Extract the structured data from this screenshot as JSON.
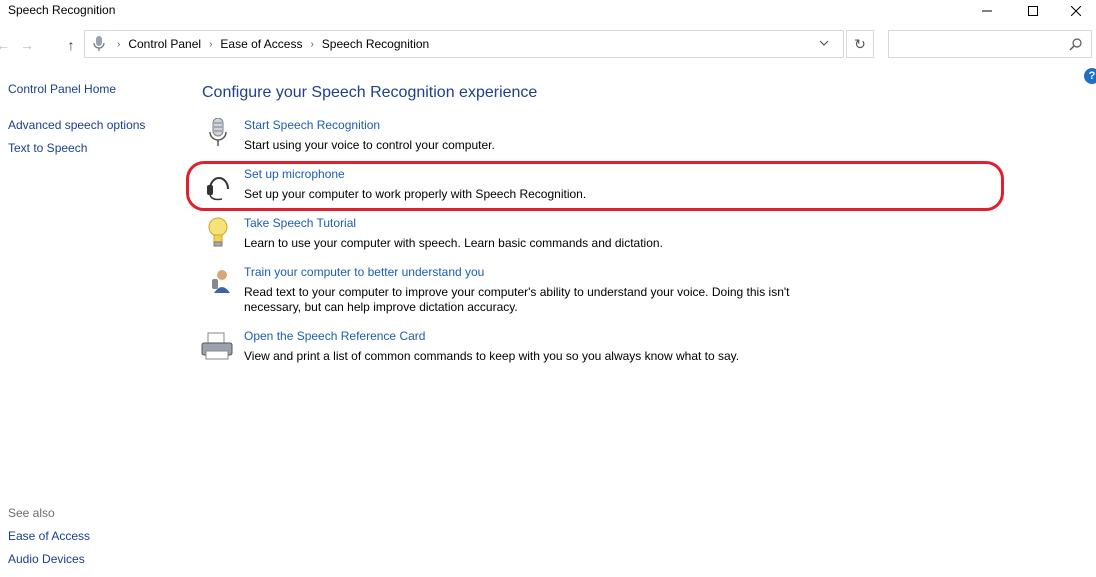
{
  "window": {
    "title": "Speech Recognition"
  },
  "breadcrumb": [
    "Control Panel",
    "Ease of Access",
    "Speech Recognition"
  ],
  "search": {
    "placeholder": ""
  },
  "sidebar": {
    "links": [
      "Control Panel Home",
      "Advanced speech options",
      "Text to Speech"
    ]
  },
  "seealso": {
    "title": "See also",
    "links": [
      "Ease of Access",
      "Audio Devices"
    ]
  },
  "main": {
    "title": "Configure your Speech Recognition experience",
    "tasks": [
      {
        "link": "Start Speech Recognition",
        "desc": "Start using your voice to control your computer.",
        "icon": "microphone-icon"
      },
      {
        "link": "Set up microphone",
        "desc": "Set up your computer to work properly with Speech Recognition.",
        "icon": "headset-icon"
      },
      {
        "link": "Take Speech Tutorial",
        "desc": "Learn to use your computer with speech.  Learn basic commands and dictation.",
        "icon": "lightbulb-icon"
      },
      {
        "link": "Train your computer to better understand you",
        "desc": "Read text to your computer to improve your computer's ability to understand your voice.  Doing this isn't necessary, but can help improve dictation accuracy.",
        "icon": "user-icon"
      },
      {
        "link": "Open the Speech Reference Card",
        "desc": "View and print a list of common commands to keep with you so you always know what to say.",
        "icon": "printer-icon"
      }
    ]
  },
  "colors": {
    "link": "#1a5eb3",
    "title": "#1e3f8a",
    "highlight": "#e0202c"
  }
}
